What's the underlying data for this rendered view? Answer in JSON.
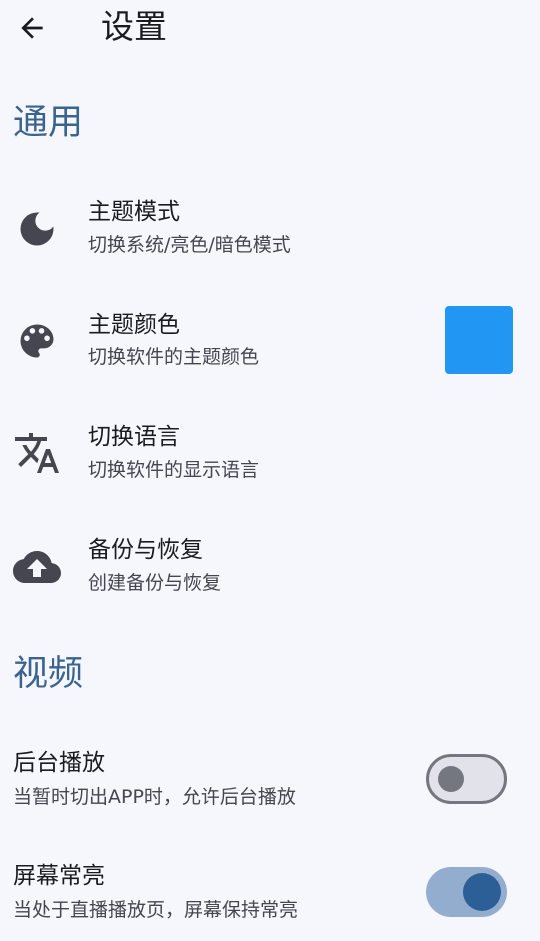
{
  "app_bar": {
    "title": "设置",
    "back_icon": "arrow-back-icon"
  },
  "sections": {
    "general": {
      "header": "通用",
      "items": [
        {
          "title": "主题模式",
          "subtitle": "切换系统/亮色/暗色模式",
          "icon": "dark-mode-moon-icon"
        },
        {
          "title": "主题颜色",
          "subtitle": "切换软件的主题颜色",
          "icon": "palette-icon",
          "swatch_color": "#2196F3"
        },
        {
          "title": "切换语言",
          "subtitle": "切换软件的显示语言",
          "icon": "translate-icon"
        },
        {
          "title": "备份与恢复",
          "subtitle": "创建备份与恢复",
          "icon": "cloud-upload-icon"
        }
      ]
    },
    "video": {
      "header": "视频",
      "items": [
        {
          "title": "后台播放",
          "subtitle": "当暂时切出APP时，允许后台播放",
          "toggle_on": false
        },
        {
          "title": "屏幕常亮",
          "subtitle": "当处于直播播放页，屏幕保持常亮",
          "toggle_on": true
        }
      ]
    }
  },
  "colors": {
    "background": "#F6F7FC",
    "section_header": "#3A6390",
    "icon": "#45464F",
    "switch_on_track": "#93ADCF",
    "switch_on_thumb": "#2C5F96",
    "switch_off_track": "#E2E3EA",
    "switch_off_outline": "#74777F"
  }
}
